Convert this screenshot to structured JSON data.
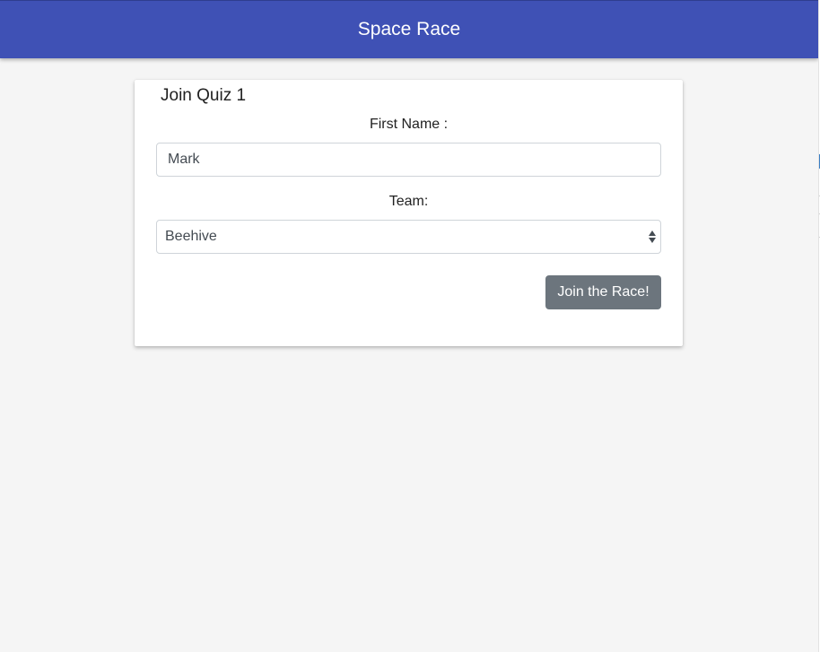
{
  "appbar": {
    "title": "Space Race",
    "color": "#3f51b5"
  },
  "card": {
    "title": "Join Quiz 1",
    "first_name": {
      "label": "First Name :",
      "value": "Mark"
    },
    "team": {
      "label": "Team:",
      "selected": "Beehive",
      "icon": "select-arrows-icon"
    },
    "join_button_label": "Join the Race!",
    "join_button_color": "#6c757d"
  }
}
